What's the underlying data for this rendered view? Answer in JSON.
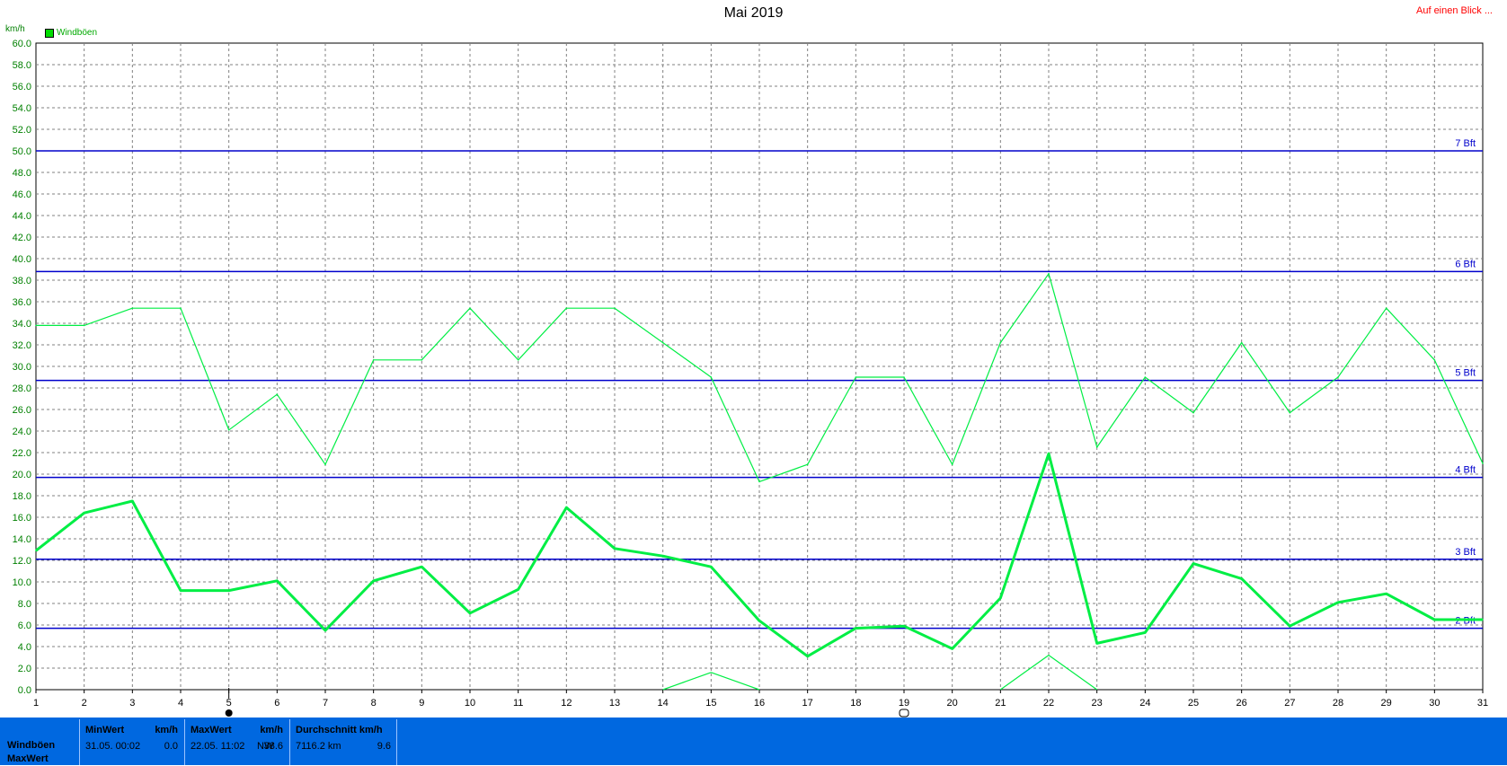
{
  "header": {
    "title": "Mai 2019",
    "top_link": "Auf einen Blick ...",
    "y_unit": "km/h",
    "legend_label": "Windböen"
  },
  "colors": {
    "gust_line": "#00ee44",
    "beaufort_line": "#0000cc",
    "grid": "#808080",
    "stats_bg": "#0068e0"
  },
  "chart_data": {
    "type": "line",
    "title": "Mai 2019",
    "ylabel": "km/h",
    "xlim": [
      1,
      31
    ],
    "ylim": [
      0,
      60
    ],
    "x_ticks": [
      "1",
      "2",
      "3",
      "4",
      "5",
      "6",
      "7",
      "8",
      "9",
      "10",
      "11",
      "12",
      "13",
      "14",
      "15",
      "16",
      "17",
      "18",
      "19",
      "20",
      "21",
      "22",
      "23",
      "24",
      "25",
      "26",
      "27",
      "28",
      "29",
      "30",
      "31"
    ],
    "y_ticks": [
      "0.0",
      "2.0",
      "4.0",
      "6.0",
      "8.0",
      "10.0",
      "12.0",
      "14.0",
      "16.0",
      "18.0",
      "20.0",
      "22.0",
      "24.0",
      "26.0",
      "28.0",
      "30.0",
      "32.0",
      "34.0",
      "36.0",
      "38.0",
      "40.0",
      "42.0",
      "44.0",
      "46.0",
      "48.0",
      "50.0",
      "52.0",
      "54.0",
      "56.0",
      "58.0",
      "60.0"
    ],
    "grid": true,
    "legend": "top-left",
    "series": [
      {
        "name": "Windböen",
        "role": "max",
        "x": [
          1,
          2,
          3,
          4,
          5,
          6,
          7,
          8,
          9,
          10,
          11,
          12,
          13,
          14,
          15,
          16,
          17,
          18,
          19,
          20,
          21,
          22,
          23,
          24,
          25,
          26,
          27,
          28,
          29,
          30,
          31
        ],
        "values": [
          33.8,
          33.8,
          35.4,
          35.4,
          24.1,
          27.4,
          20.9,
          30.6,
          30.6,
          35.4,
          30.6,
          35.4,
          35.4,
          32.2,
          29.0,
          19.3,
          20.9,
          29.0,
          29.0,
          20.9,
          32.2,
          38.6,
          22.5,
          29.0,
          25.7,
          32.2,
          25.7,
          29.0,
          35.4,
          30.6,
          21.0
        ]
      },
      {
        "role": "avg",
        "x": [
          1,
          2,
          3,
          4,
          5,
          6,
          7,
          8,
          9,
          10,
          11,
          12,
          13,
          14,
          15,
          16,
          17,
          18,
          19,
          20,
          21,
          22,
          23,
          24,
          25,
          26,
          27,
          28,
          29,
          30,
          31
        ],
        "values": [
          12.9,
          16.4,
          17.5,
          9.2,
          9.2,
          10.1,
          5.5,
          10.1,
          11.4,
          7.1,
          9.3,
          16.9,
          13.1,
          12.4,
          11.4,
          6.4,
          3.1,
          5.7,
          5.9,
          3.8,
          8.5,
          21.9,
          4.3,
          5.3,
          11.7,
          10.3,
          5.9,
          8.1,
          8.9,
          6.5,
          6.5
        ]
      },
      {
        "role": "min",
        "x": [
          14,
          15,
          16,
          21,
          22,
          23
        ],
        "values": [
          0.0,
          1.6,
          0.0,
          0.0,
          3.2,
          0.0
        ]
      }
    ],
    "beaufort_lines": [
      {
        "label": "7 Bft",
        "value": 50.0
      },
      {
        "label": "6 Bft",
        "value": 38.8
      },
      {
        "label": "5 Bft",
        "value": 28.7
      },
      {
        "label": "4 Bft",
        "value": 19.7
      },
      {
        "label": "3 Bft",
        "value": 12.1
      },
      {
        "label": "2 Bft",
        "value": 5.7
      }
    ]
  },
  "stats": {
    "row_labels": [
      "Windböen",
      "MaxWert"
    ],
    "min": {
      "head": "MinWert",
      "unit": "km/h",
      "date": "31.05.  00:02",
      "value": "0.0"
    },
    "max": {
      "head": "MaxWert",
      "unit": "km/h",
      "date": "22.05.  11:02",
      "dir": "NW",
      "value": "38.6"
    },
    "avg": {
      "head": "Durchschnitt km/h",
      "dist": "7116.2 km",
      "value": "9.6"
    }
  }
}
